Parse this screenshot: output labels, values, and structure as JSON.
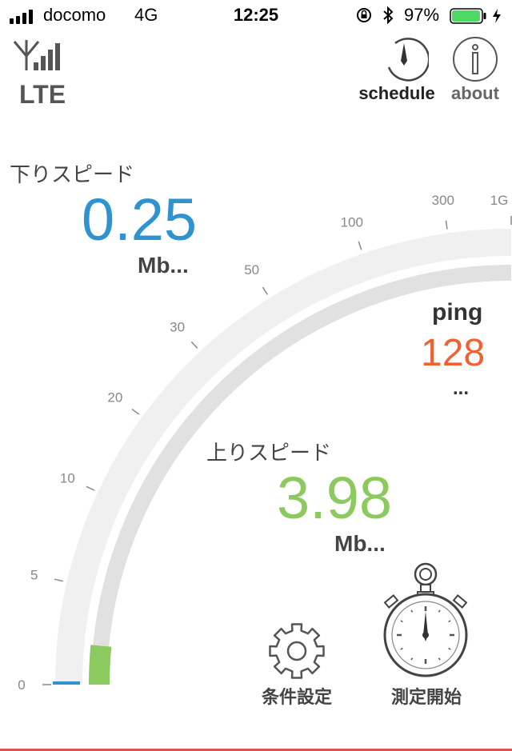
{
  "status_bar": {
    "carrier": "docomo",
    "network": "4G",
    "time": "12:25",
    "battery_percent": "97%",
    "battery_level": 0.97,
    "battery_color": "#4cd964"
  },
  "header": {
    "network_type": "LTE",
    "schedule_label": "schedule",
    "about_label": "about"
  },
  "download": {
    "label": "下りスピード",
    "value": "0.25",
    "unit": "Mb...",
    "color": "#2e93cf"
  },
  "ping": {
    "label": "ping",
    "value": "128",
    "unit": "...",
    "color": "#ef6232"
  },
  "upload": {
    "label": "上りスピード",
    "value": "3.98",
    "unit": "Mb...",
    "color": "#8cc95e"
  },
  "gauge": {
    "ticks": [
      "0",
      "5",
      "10",
      "20",
      "30",
      "50",
      "100",
      "300",
      "1G"
    ],
    "download_level": 0.0,
    "upload_level": 0.06
  },
  "controls": {
    "settings_label": "条件設定",
    "start_label": "測定開始"
  }
}
